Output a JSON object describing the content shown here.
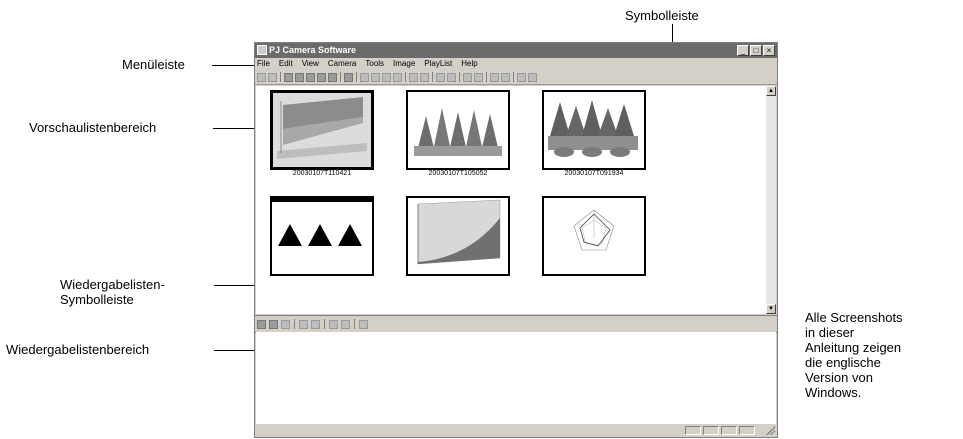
{
  "annotations": {
    "symbolleiste": "Symbolleiste",
    "menueleiste": "Menüleiste",
    "vorschau": "Vorschaulistenbereich",
    "wiedergabe_symbol_1": "Wiedergabelisten-",
    "wiedergabe_symbol_2": "Symbolleiste",
    "wiedergabe_bereich": "Wiedergabelistenbereich",
    "note": [
      "Alle Screenshots",
      "in dieser",
      "Anleitung zeigen",
      "die englische",
      "Version von",
      "Windows."
    ]
  },
  "window": {
    "title": "PJ Camera Software",
    "menu": [
      "File",
      "Edit",
      "View",
      "Camera",
      "Tools",
      "Image",
      "PlayList",
      "Help"
    ]
  },
  "thumbnails": [
    {
      "caption": "20030107T110421"
    },
    {
      "caption": "20030107T105052"
    },
    {
      "caption": "20030107T091934"
    },
    {
      "caption": ""
    },
    {
      "caption": ""
    },
    {
      "caption": ""
    }
  ],
  "colors": {
    "titlebar": "#6b6b6b",
    "face": "#d4d0c8"
  }
}
